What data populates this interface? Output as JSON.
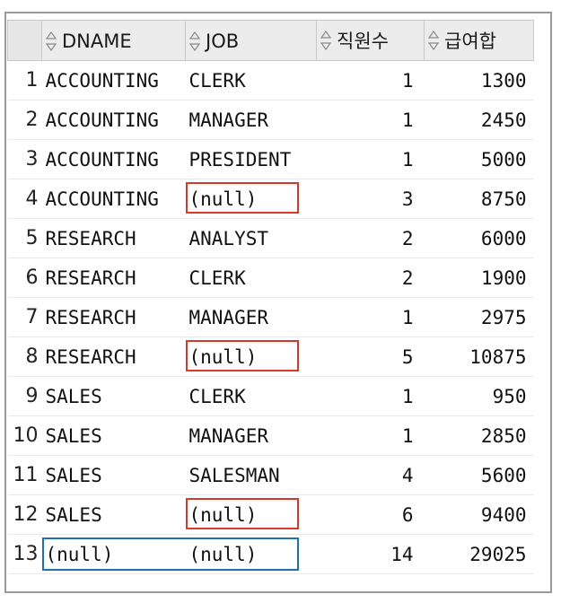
{
  "columns": {
    "row_num": "",
    "dname": "DNAME",
    "job": "JOB",
    "count": "직원수",
    "salary": "급여합"
  },
  "rows": [
    {
      "n": "1",
      "dname": "ACCOUNTING",
      "job": "CLERK",
      "count": "1",
      "salary": "1300"
    },
    {
      "n": "2",
      "dname": "ACCOUNTING",
      "job": "MANAGER",
      "count": "1",
      "salary": "2450"
    },
    {
      "n": "3",
      "dname": "ACCOUNTING",
      "job": "PRESIDENT",
      "count": "1",
      "salary": "5000"
    },
    {
      "n": "4",
      "dname": "ACCOUNTING",
      "job": "(null)",
      "count": "3",
      "salary": "8750"
    },
    {
      "n": "5",
      "dname": "RESEARCH",
      "job": "ANALYST",
      "count": "2",
      "salary": "6000"
    },
    {
      "n": "6",
      "dname": "RESEARCH",
      "job": "CLERK",
      "count": "2",
      "salary": "1900"
    },
    {
      "n": "7",
      "dname": "RESEARCH",
      "job": "MANAGER",
      "count": "1",
      "salary": "2975"
    },
    {
      "n": "8",
      "dname": "RESEARCH",
      "job": "(null)",
      "count": "5",
      "salary": "10875"
    },
    {
      "n": "9",
      "dname": "SALES",
      "job": "CLERK",
      "count": "1",
      "salary": "950"
    },
    {
      "n": "10",
      "dname": "SALES",
      "job": "MANAGER",
      "count": "1",
      "salary": "2850"
    },
    {
      "n": "11",
      "dname": "SALES",
      "job": "SALESMAN",
      "count": "4",
      "salary": "5600"
    },
    {
      "n": "12",
      "dname": "SALES",
      "job": "(null)",
      "count": "6",
      "salary": "9400"
    },
    {
      "n": "13",
      "dname": "(null)",
      "job": "(null)",
      "count": "14",
      "salary": "29025"
    }
  ],
  "highlights": {
    "red_color": "#d8382a",
    "blue_color": "#1f6fb5",
    "red_rows": [
      4,
      8,
      12
    ],
    "blue_rows": [
      13
    ]
  },
  "icons": {
    "sort": "sort-arrows-icon"
  }
}
